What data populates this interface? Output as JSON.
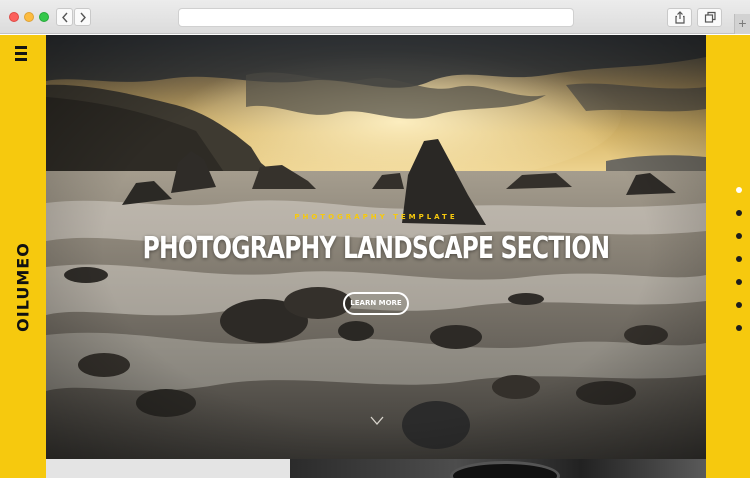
{
  "browser": {
    "back_icon": "chevron-left-icon",
    "forward_icon": "chevron-right-icon",
    "url": "",
    "share_icon": "share-icon",
    "tabs_icon": "tabs-icon",
    "new_tab_label": "+"
  },
  "site": {
    "logo": "OILUMEO",
    "menu_icon": "hamburger-icon"
  },
  "hero": {
    "kicker": "PHOTOGRAPHY TEMPLATE",
    "title": "PHOTOGRAPHY LANDSCAPE SECTION",
    "button_label": "LEARN MORE",
    "scroll_icon": "chevron-down-icon"
  },
  "pagination": {
    "count": 7,
    "active_index": 0
  },
  "colors": {
    "accent": "#f6c90e",
    "text_dark": "#111111",
    "hero_text": "#ffffff"
  }
}
